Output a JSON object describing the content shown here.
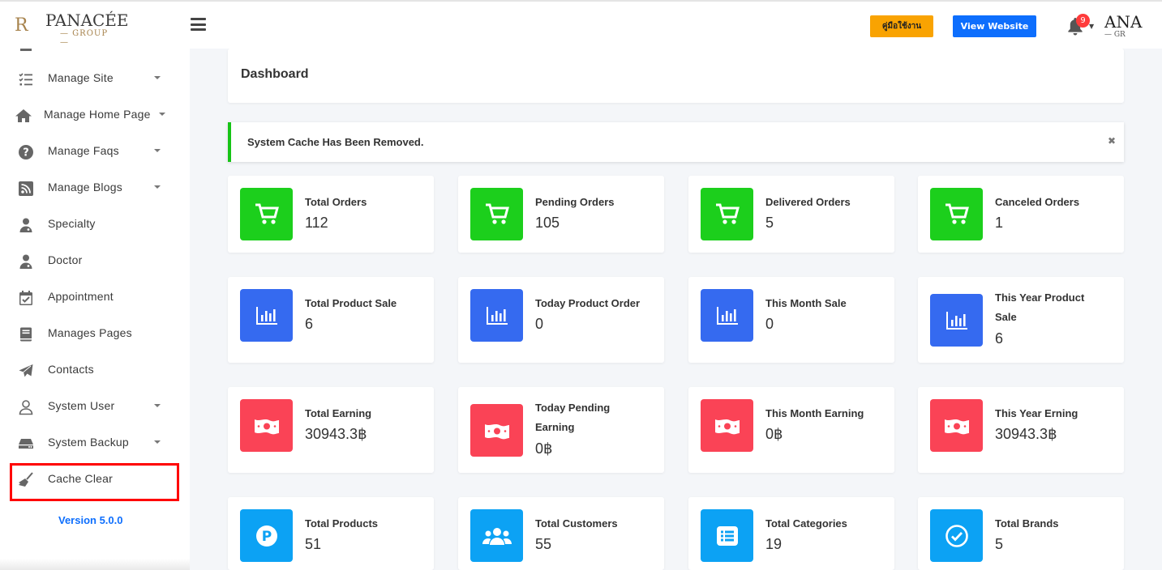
{
  "brand": {
    "logo_mark": "R",
    "logo_name": "PANACÉE",
    "logo_sub": "— GROUP —",
    "user_logo_line1": "ANA",
    "user_logo_line2": "— GR"
  },
  "header": {
    "manual_label": "คู่มือใช้งาน",
    "website_label": "View Website",
    "notification_count": "9"
  },
  "sidebar": {
    "items": [
      {
        "label": "Manage Site",
        "icon": "checklist-icon",
        "has_caret": true
      },
      {
        "label": "Manage Home Page",
        "icon": "home-icon",
        "has_caret": true
      },
      {
        "label": "Manage Faqs",
        "icon": "question-icon",
        "has_caret": true
      },
      {
        "label": "Manage Blogs",
        "icon": "rss-icon",
        "has_caret": true
      },
      {
        "label": "Specialty",
        "icon": "doctor-icon",
        "has_caret": false
      },
      {
        "label": "Doctor",
        "icon": "doctor-icon",
        "has_caret": false
      },
      {
        "label": "Appointment",
        "icon": "calendar-check-icon",
        "has_caret": false
      },
      {
        "label": "Manages Pages",
        "icon": "book-icon",
        "has_caret": false
      },
      {
        "label": "Contacts",
        "icon": "paper-plane-icon",
        "has_caret": false
      },
      {
        "label": "System User",
        "icon": "user-icon",
        "has_caret": true
      },
      {
        "label": "System Backup",
        "icon": "hdd-icon",
        "has_caret": true
      },
      {
        "label": "Cache Clear",
        "icon": "broom-icon",
        "has_caret": false
      }
    ],
    "version": "Version 5.0.0"
  },
  "main": {
    "page_title": "Dashboard",
    "alert_message": "System Cache Has Been Removed.",
    "alert_close": "✖",
    "cards": [
      {
        "title": "Total Orders",
        "value": "112",
        "color": "#1ccf1c",
        "icon": "cart-icon"
      },
      {
        "title": "Pending Orders",
        "value": "105",
        "color": "#1ccf1c",
        "icon": "cart-icon"
      },
      {
        "title": "Delivered Orders",
        "value": "5",
        "color": "#1ccf1c",
        "icon": "cart-icon"
      },
      {
        "title": "Canceled Orders",
        "value": "1",
        "color": "#1ccf1c",
        "icon": "cart-icon"
      },
      {
        "title": "Total Product Sale",
        "value": "6",
        "color": "#356af0",
        "icon": "bar-chart-icon"
      },
      {
        "title": "Today Product Order",
        "value": "0",
        "color": "#356af0",
        "icon": "bar-chart-icon"
      },
      {
        "title": "This Month Sale",
        "value": "0",
        "color": "#356af0",
        "icon": "bar-chart-icon"
      },
      {
        "title": "This Year Product Sale",
        "value": "6",
        "color": "#356af0",
        "icon": "bar-chart-icon"
      },
      {
        "title": "Total Earning",
        "value": "30943.3฿",
        "color": "#fa4356",
        "icon": "money-icon"
      },
      {
        "title": "Today Pending Earning",
        "value": "0฿",
        "color": "#fa4356",
        "icon": "money-icon"
      },
      {
        "title": "This Month Earning",
        "value": "0฿",
        "color": "#fa4356",
        "icon": "money-icon"
      },
      {
        "title": "This Year Erning",
        "value": "30943.3฿",
        "color": "#fa4356",
        "icon": "money-icon"
      },
      {
        "title": "Total Products",
        "value": "51",
        "color": "#0ca2f4",
        "icon": "parking-icon"
      },
      {
        "title": "Total Customers",
        "value": "55",
        "color": "#0ca2f4",
        "icon": "users-icon"
      },
      {
        "title": "Total Categories",
        "value": "19",
        "color": "#0ca2f4",
        "icon": "list-icon"
      },
      {
        "title": "Total Brands",
        "value": "5",
        "color": "#0ca2f4",
        "icon": "check-circle-icon"
      }
    ]
  }
}
